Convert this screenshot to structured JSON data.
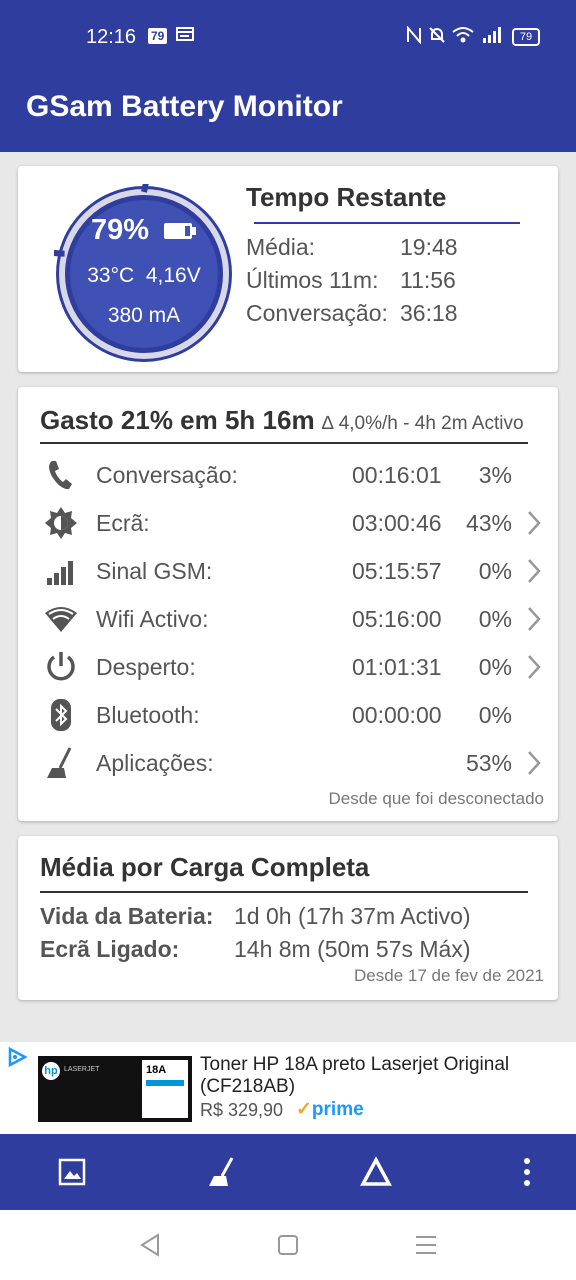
{
  "status_bar": {
    "time": "12:16",
    "notif_badge": "79",
    "battery_level": "79"
  },
  "app_bar": {
    "title": "GSam Battery Monitor"
  },
  "battery_card": {
    "percent": "79%",
    "temperature": "33°C",
    "voltage": "4,16V",
    "current": "380 mA",
    "gauge_fraction": 0.79,
    "time_left": {
      "title": "Tempo Restante",
      "rows": [
        {
          "label": "Média:",
          "value": "19:48"
        },
        {
          "label": "Últimos 11m:",
          "value": "11:56"
        },
        {
          "label": "Conversação:",
          "value": "36:18"
        }
      ]
    }
  },
  "usage_card": {
    "title": "Gasto 21% em 5h 16m",
    "subtitle": "∆ 4,0%/h - 4h 2m Activo",
    "rows": [
      {
        "icon": "phone-icon",
        "label": "Conversação:",
        "time": "00:16:01",
        "pct": "3%",
        "chevron": false
      },
      {
        "icon": "brightness-icon",
        "label": "Ecrã:",
        "time": "03:00:46",
        "pct": "43%",
        "chevron": true
      },
      {
        "icon": "signal-icon",
        "label": "Sinal GSM:",
        "time": "05:15:57",
        "pct": "0%",
        "chevron": true
      },
      {
        "icon": "wifi-icon",
        "label": "Wifi Activo:",
        "time": "05:16:00",
        "pct": "0%",
        "chevron": true
      },
      {
        "icon": "power-icon",
        "label": "Desperto:",
        "time": "01:01:31",
        "pct": "0%",
        "chevron": true
      },
      {
        "icon": "bluetooth-icon",
        "label": "Bluetooth:",
        "time": "00:00:00",
        "pct": "0%",
        "chevron": false
      },
      {
        "icon": "apps-broom-icon",
        "label": "Aplicações:",
        "time": "",
        "pct": "53%",
        "chevron": true
      }
    ],
    "footer": "Desde que foi desconectado"
  },
  "average_card": {
    "title": "Média por Carga Completa",
    "rows": [
      {
        "label": "Vida da Bateria:",
        "value": "1d 0h (17h 37m Activo)"
      },
      {
        "label": "Ecrã Ligado:",
        "value": "14h 8m (50m 57s Máx)"
      }
    ],
    "footer": "Desde 17 de fev de 2021"
  },
  "ad": {
    "line1": "Toner HP 18A preto Laserjet Original",
    "line2": "(CF218AB)",
    "price": "R$ 329,90",
    "prime_check": "✓",
    "prime": "prime",
    "product_label": "18A",
    "product_brand": "LASERJET"
  },
  "colors": {
    "primary": "#2f3d9e",
    "card": "#ffffff",
    "background": "#e8e8e8"
  }
}
